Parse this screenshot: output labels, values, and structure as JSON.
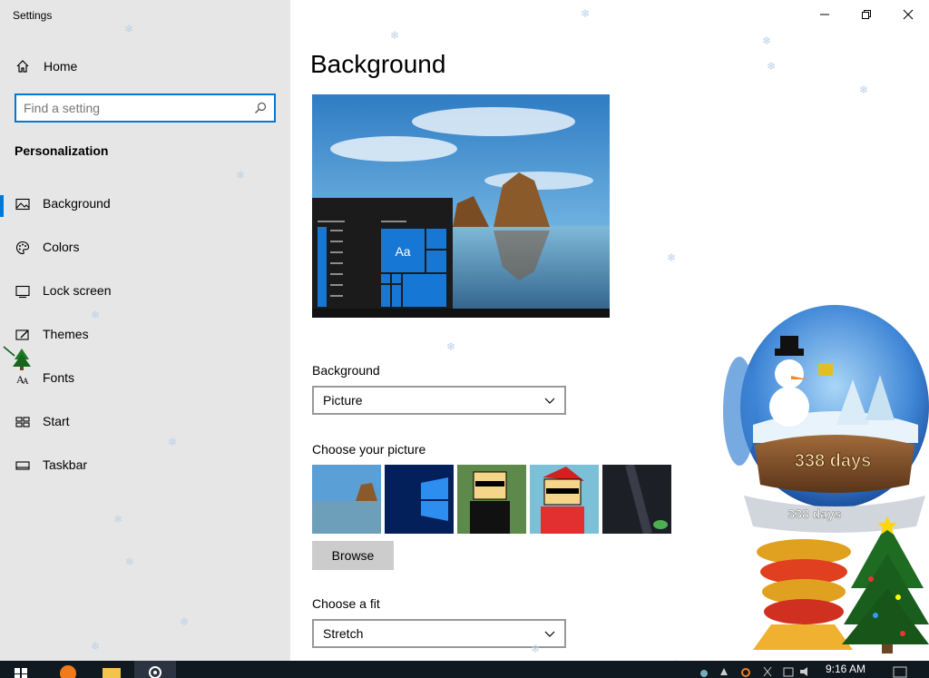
{
  "window": {
    "title": "Settings",
    "controls": {
      "minimize": "minimize",
      "maximize": "maximize",
      "close": "close"
    }
  },
  "sidebar": {
    "home_label": "Home",
    "search_placeholder": "Find a setting",
    "section_title": "Personalization",
    "items": [
      {
        "label": "Background",
        "icon": "picture-icon",
        "active": true
      },
      {
        "label": "Colors",
        "icon": "palette-icon",
        "active": false
      },
      {
        "label": "Lock screen",
        "icon": "lock-screen-icon",
        "active": false
      },
      {
        "label": "Themes",
        "icon": "themes-icon",
        "active": false
      },
      {
        "label": "Fonts",
        "icon": "fonts-icon",
        "active": false
      },
      {
        "label": "Start",
        "icon": "start-icon",
        "active": false
      },
      {
        "label": "Taskbar",
        "icon": "taskbar-icon",
        "active": false
      }
    ]
  },
  "main": {
    "page_title": "Background",
    "preview_tile_text": "Aa",
    "background_label": "Background",
    "background_value": "Picture",
    "choose_picture_label": "Choose your picture",
    "browse_label": "Browse",
    "choose_fit_label": "Choose a fit",
    "fit_value": "Stretch"
  },
  "widget": {
    "days_text": "338 days",
    "days_text_base": "338 days"
  },
  "taskbar": {
    "clock": "9:16 AM"
  },
  "colors": {
    "accent": "#0078d7",
    "sidebar_bg": "#e6e6e6",
    "taskbar_bg": "#101820"
  }
}
